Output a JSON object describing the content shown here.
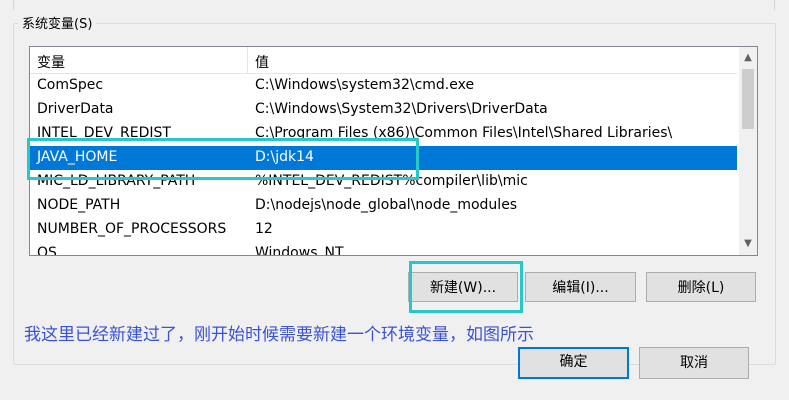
{
  "group": {
    "title": "系统变量(S)"
  },
  "list": {
    "headers": {
      "name": "变量",
      "value": "值"
    },
    "rows": [
      {
        "name": "ComSpec",
        "value": "C:\\Windows\\system32\\cmd.exe"
      },
      {
        "name": "DriverData",
        "value": "C:\\Windows\\System32\\Drivers\\DriverData"
      },
      {
        "name": "INTEL_DEV_REDIST",
        "value": "C:\\Program Files (x86)\\Common Files\\Intel\\Shared Libraries\\"
      },
      {
        "name": "JAVA_HOME",
        "value": "D:\\jdk14"
      },
      {
        "name": "MIC_LD_LIBRARY_PATH",
        "value": "%INTEL_DEV_REDIST%compiler\\lib\\mic"
      },
      {
        "name": "NODE_PATH",
        "value": "D:\\nodejs\\node_global\\node_modules"
      },
      {
        "name": "NUMBER_OF_PROCESSORS",
        "value": "12"
      },
      {
        "name": "OS",
        "value": "Windows_NT"
      }
    ],
    "selected_index": 3
  },
  "buttons": {
    "new": "新建(W)...",
    "edit": "编辑(I)...",
    "delete": "删除(L)",
    "ok": "确定",
    "cancel": "取消"
  },
  "annotation": "我这里已经新建过了，刚开始时候需要新建一个环境变量，如图所示",
  "colors": {
    "selection": "#0078d7",
    "highlight_box": "#28c8c8",
    "annotation_text": "#3a52d6"
  },
  "icons": {
    "scroll_up": "chevron-up-icon",
    "scroll_down": "chevron-down-icon"
  }
}
